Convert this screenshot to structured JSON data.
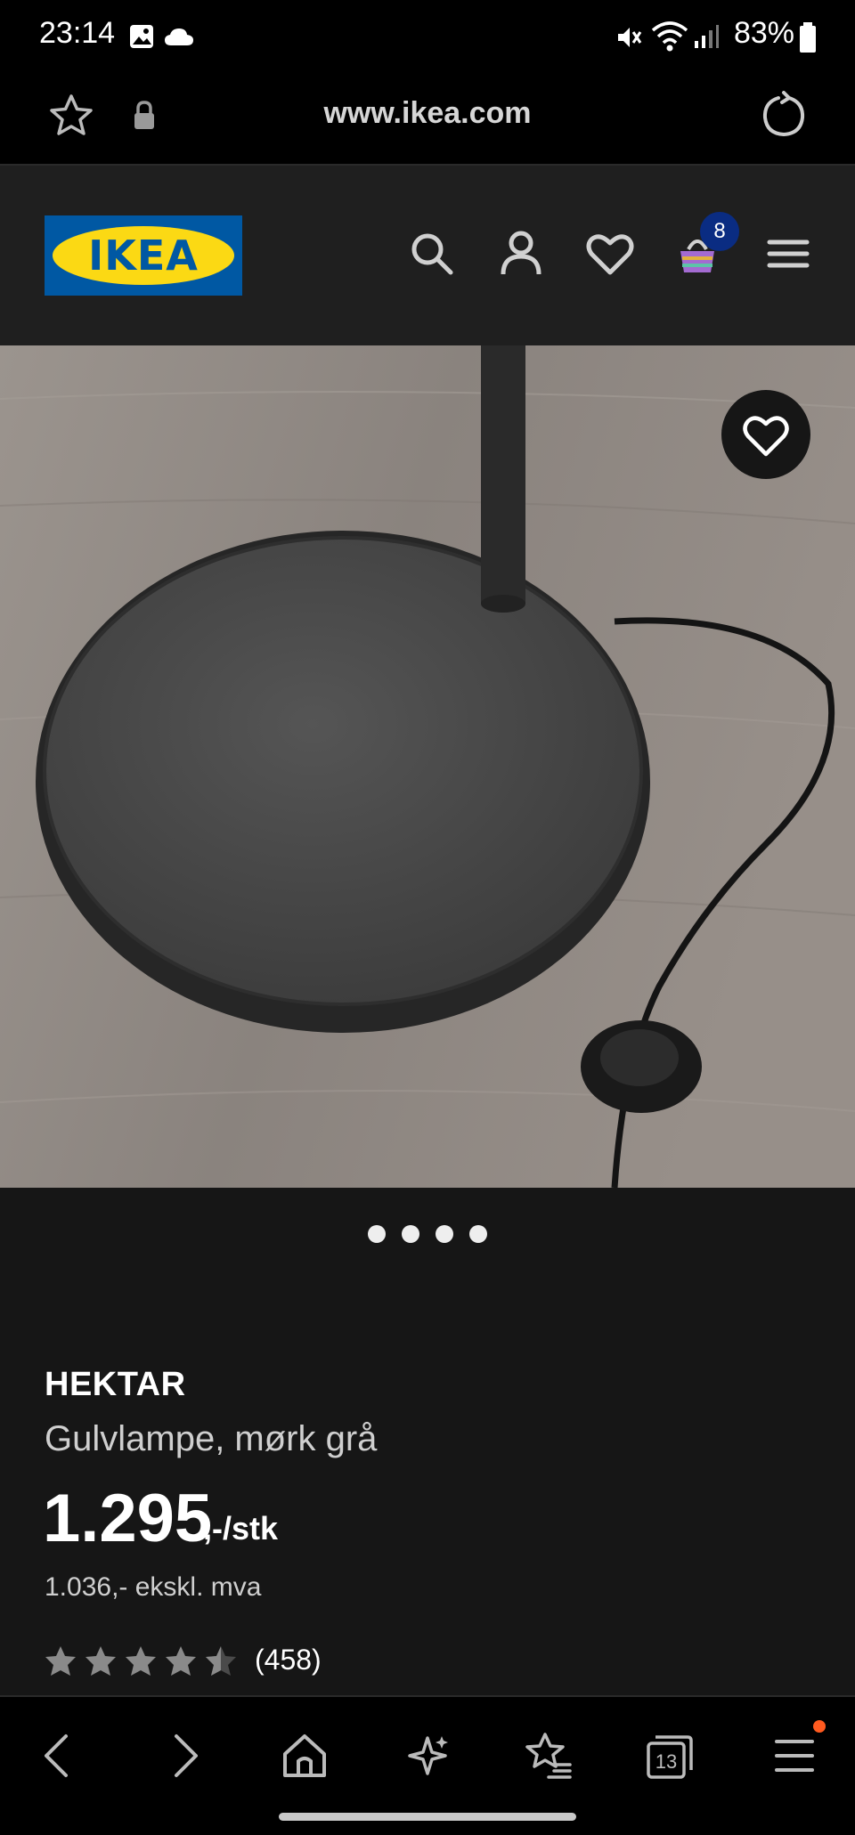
{
  "status_bar": {
    "time": "23:14",
    "battery": "83%",
    "icons": [
      "gallery-icon",
      "cloud-icon",
      "mute-icon",
      "wifi-icon",
      "signal-icon",
      "battery-icon"
    ]
  },
  "browser": {
    "url": "www.ikea.com",
    "tab_count": "13"
  },
  "header": {
    "logo_text": "IKEA",
    "cart_count": "8",
    "colors": {
      "logo_blue": "#0058a3",
      "logo_yellow": "#fbd914"
    }
  },
  "product": {
    "name": "HEKTAR",
    "description": "Gulvlampe, mørk grå",
    "price": "1.295",
    "price_suffix": ",-/stk",
    "price_excl_vat": "1.036,- ekskl. mva",
    "rating": 4.5,
    "review_count": "(458)"
  },
  "carousel": {
    "slides": 4,
    "active": 0
  }
}
